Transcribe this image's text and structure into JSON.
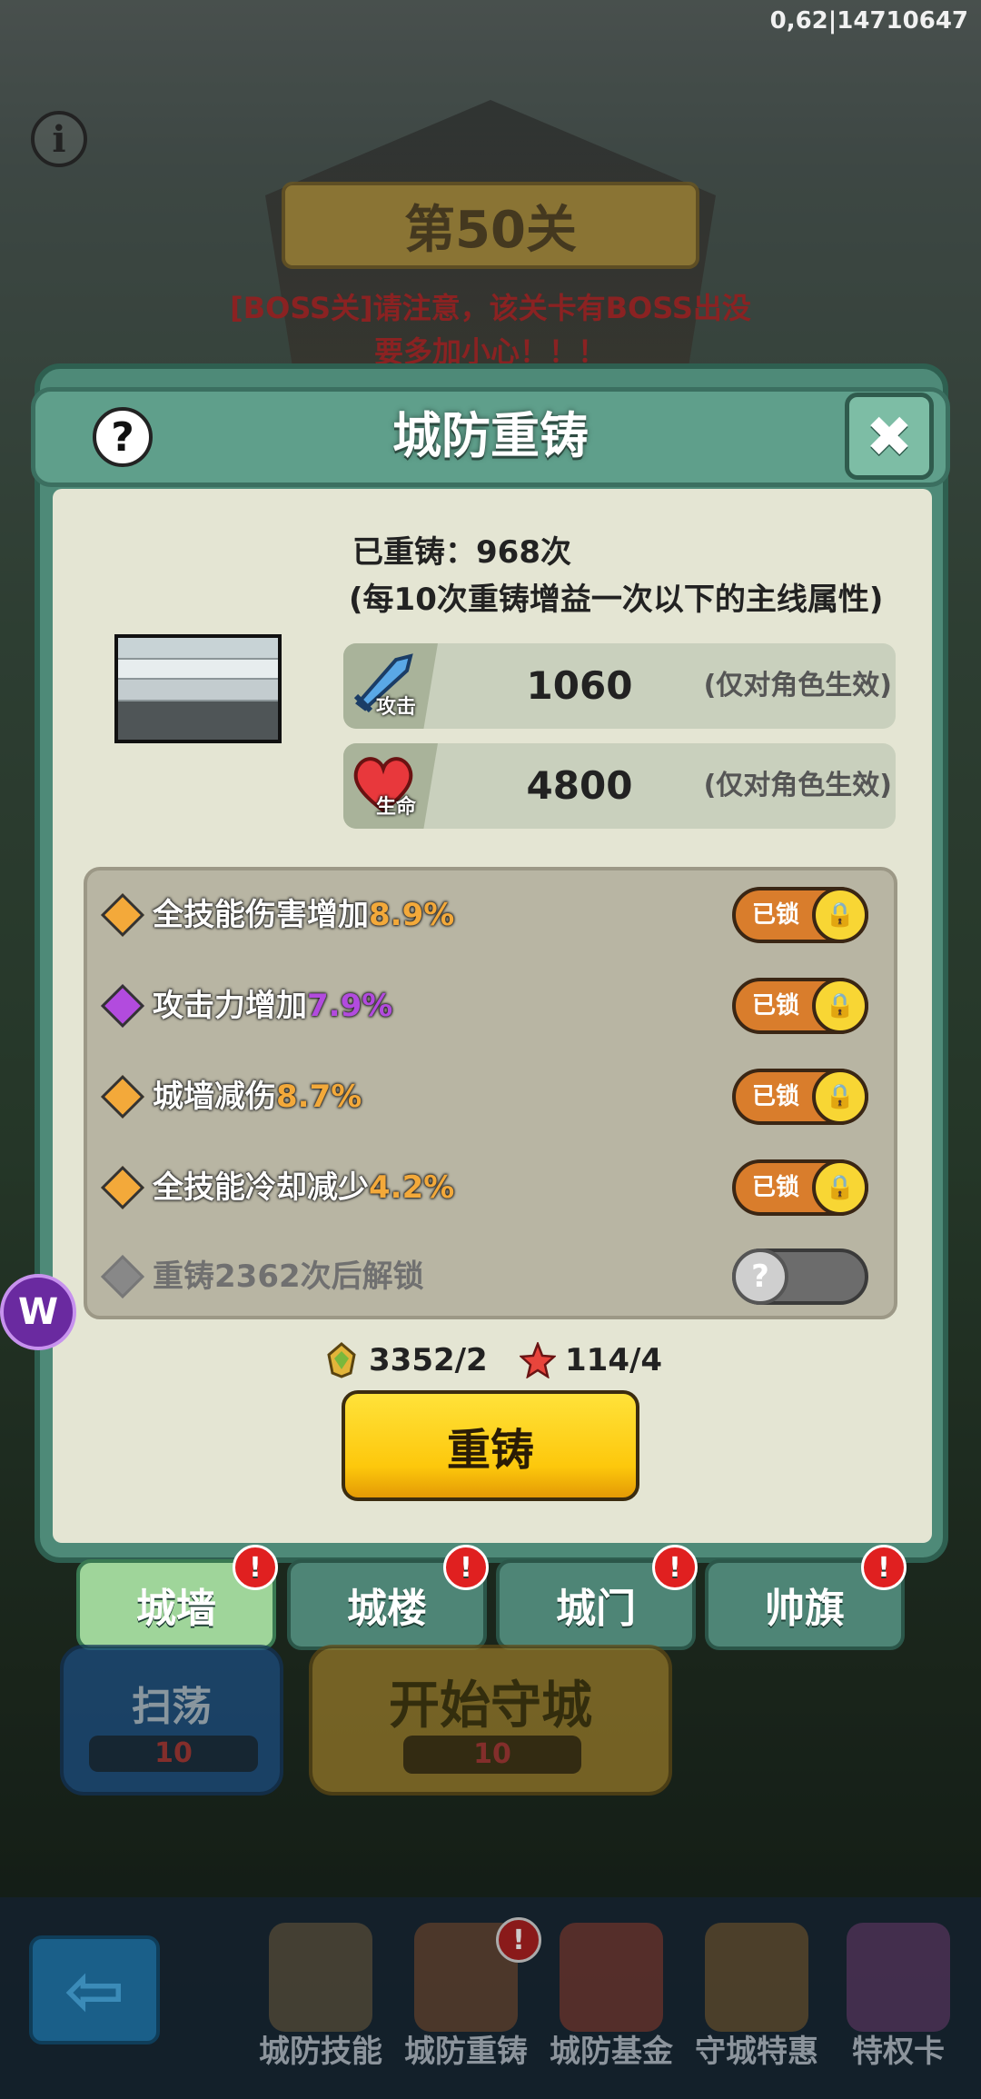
{
  "status_corner": "0,62|14710647",
  "level_title": "第50关",
  "boss_notice": [
    "[BOSS关]请注意，该关卡有BOSS出没",
    "要多加小心！！！"
  ],
  "panel": {
    "title": "城防重铸",
    "help_symbol": "?",
    "close_symbol": "✖"
  },
  "reforge_info": {
    "count_text": "已重铸：968次",
    "sub_text": "(每10次重铸增益一次以下的主线属性)"
  },
  "stats": [
    {
      "icon": "sword-icon",
      "label": "攻击",
      "value": "1060",
      "note": "(仅对角色生效)"
    },
    {
      "icon": "heart-icon",
      "label": "生命",
      "value": "4800",
      "note": "(仅对角色生效)"
    }
  ],
  "attributes": [
    {
      "gem_color": "#f3a93a",
      "name": "全技能伤害增加",
      "value": "8.9%",
      "state": "已锁",
      "locked": true
    },
    {
      "gem_color": "#b24bde",
      "name": "攻击力增加",
      "value": "7.9%",
      "state": "已锁",
      "locked": true
    },
    {
      "gem_color": "#f3a93a",
      "name": "城墙减伤",
      "value": "8.7%",
      "state": "已锁",
      "locked": true
    },
    {
      "gem_color": "#f3a93a",
      "name": "全技能冷却减少",
      "value": "4.2%",
      "state": "已锁",
      "locked": true
    },
    {
      "gem_color": "#888888",
      "name": "重铸2362次后解锁",
      "value": "",
      "state": "?",
      "locked": false
    }
  ],
  "costs": [
    {
      "icon": "leaf-gem-icon",
      "text": "3352/2"
    },
    {
      "icon": "red-star-icon",
      "text": "114/4"
    }
  ],
  "reforge_button": "重铸",
  "tabs": [
    {
      "label": "城墙",
      "active": true,
      "badge": "!"
    },
    {
      "label": "城楼",
      "active": false,
      "badge": "!"
    },
    {
      "label": "城门",
      "active": false,
      "badge": "!"
    },
    {
      "label": "帅旗",
      "active": false,
      "badge": "!"
    }
  ],
  "sweep": {
    "label": "扫荡",
    "cost": "10"
  },
  "start": {
    "label": "开始守城",
    "cost": "10"
  },
  "bottom_nav": [
    {
      "label": "城防技能",
      "color": "#6b5a3a",
      "badge": ""
    },
    {
      "label": "城防重铸",
      "color": "#7a4a2a",
      "badge": "!"
    },
    {
      "label": "城防基金",
      "color": "#8a3a2a",
      "badge": ""
    },
    {
      "label": "守城特惠",
      "color": "#7a5a2a",
      "badge": ""
    },
    {
      "label": "特权卡",
      "color": "#6a3a6a",
      "badge": ""
    }
  ],
  "colors": {
    "panel_green": "#4e8a78",
    "accent_yellow": "#fdc80c",
    "lock_orange": "#d97d2c",
    "badge_red": "#e02020"
  }
}
